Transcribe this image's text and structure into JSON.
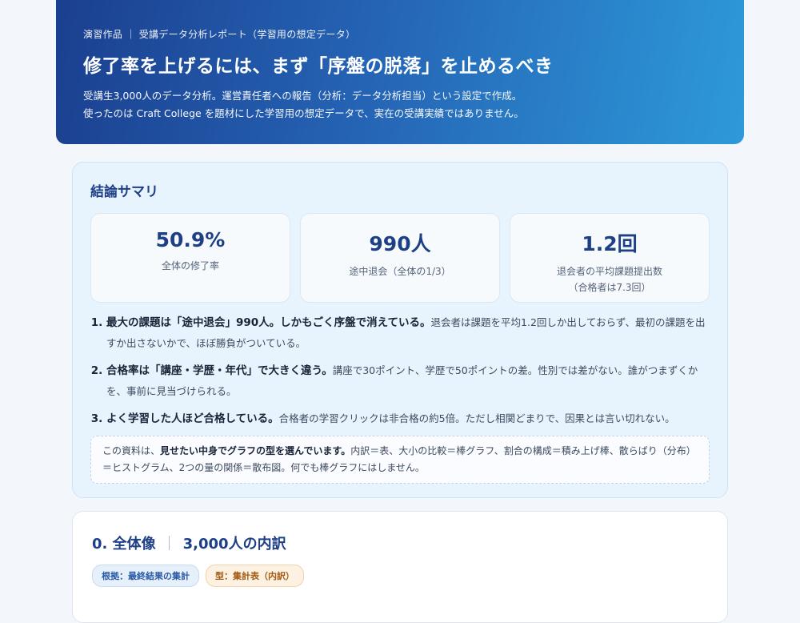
{
  "header": {
    "eyebrow": "演習作品 ｜ 受講データ分析レポート（学習用の想定データ）",
    "title": "修了率を上げるには、まず「序盤の脱落」を止めるべき",
    "lead_line1": "受講生3,000人のデータ分析。運営責任者への報告（分析：データ分析担当）という設定で作成。",
    "lead_line2": "使ったのは Craft College を題材にした学習用の想定データで、実在の受講実績ではありません。"
  },
  "summary": {
    "title": "結論サマリ",
    "kpis": [
      {
        "value": "50.9%",
        "label": "全体の修了率",
        "sub": ""
      },
      {
        "value": "990人",
        "label": "途中退会（全体の1/3）",
        "sub": ""
      },
      {
        "value": "1.2回",
        "label": "退会者の平均課題提出数",
        "sub": "（合格者は7.3回）"
      }
    ],
    "findings": [
      {
        "bold": "最大の課題は「途中退会」990人。しかもごく序盤で消えている。",
        "rest": "退会者は課題を平均1.2回しか出しておらず、最初の課題を出すか出さないかで、ほぼ勝負がついている。"
      },
      {
        "bold": "合格率は「講座・学歴・年代」で大きく違う。",
        "rest": "講座で30ポイント、学歴で50ポイントの差。性別では差がない。誰がつまずくかを、事前に見当づけられる。"
      },
      {
        "bold": "よく学習した人ほど合格している。",
        "rest": "合格者の学習クリックは非合格の約5倍。ただし相関どまりで、因果とは言い切れない。"
      }
    ],
    "note_pre": "この資料は、",
    "note_bold": "見せたい中身でグラフの型を選んでいます。",
    "note_post": "内訳＝表、大小の比較＝棒グラフ、割合の構成＝積み上げ棒、散らばり（分布）＝ヒストグラム、2つの量の関係＝散布図。何でも棒グラフにはしません。"
  },
  "section0": {
    "title_left": "0. 全体像",
    "title_sep": "｜",
    "title_right": "3,000人の内訳",
    "tag_basis": "根拠：最終結果の集計",
    "tag_type": "型：集計表（内訳）"
  }
}
